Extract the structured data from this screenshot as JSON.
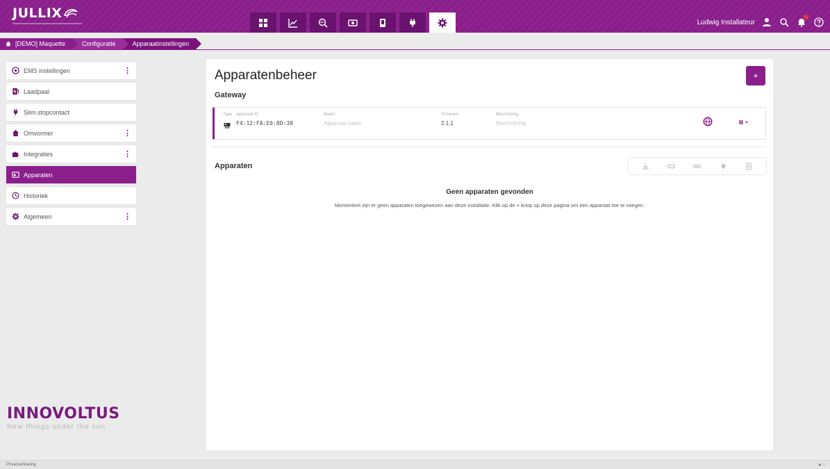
{
  "app": {
    "logo": "JULLIX"
  },
  "colors": {
    "brand": "#8a1f8c",
    "brand_dark": "#6a1270",
    "panel": "#ffffff",
    "background": "#ebebeb",
    "notification": "#e53935"
  },
  "header": {
    "nav_tabs": [
      {
        "icon": "dashboard-icon",
        "active": false
      },
      {
        "icon": "chart-icon",
        "active": false
      },
      {
        "icon": "analytics-icon",
        "active": false
      },
      {
        "icon": "money-icon",
        "active": false
      },
      {
        "icon": "phone-icon",
        "active": false
      },
      {
        "icon": "plug-icon",
        "active": false
      },
      {
        "icon": "gear-icon",
        "active": true
      }
    ],
    "user_name": "Ludwig Installateur"
  },
  "breadcrumb": {
    "home": "[DEMO] Maquette",
    "level2": "Configuratie",
    "level3": "Apparaatinstellingen"
  },
  "sidebar": {
    "items": [
      {
        "label": "EMS instellingen",
        "icon": "ems-icon",
        "has_menu": true
      },
      {
        "label": "Laadpaal",
        "icon": "charger-icon",
        "has_menu": false
      },
      {
        "label": "Slim stopcontact",
        "icon": "plug-icon",
        "has_menu": false
      },
      {
        "label": "Omvormer",
        "icon": "home-icon",
        "has_menu": true
      },
      {
        "label": "Integraties",
        "icon": "puzzle-icon",
        "has_menu": true
      },
      {
        "label": "Apparaten",
        "icon": "device-icon",
        "has_menu": false,
        "active": true
      },
      {
        "label": "Historiek",
        "icon": "history-icon",
        "has_menu": false
      },
      {
        "label": "Algemeen",
        "icon": "gear-icon",
        "has_menu": true
      }
    ],
    "brand": {
      "name": "INNOVOLTUS",
      "tagline": "New things under the sun"
    }
  },
  "main": {
    "title": "Apparatenbeheer",
    "add_label": "+",
    "gateway": {
      "title": "Gateway",
      "type_label": "Type",
      "device_id_label": "Apparaat ID",
      "device_id": "F4:12:FA:E0:8D:38",
      "name_label": "Naam",
      "name_placeholder": "Apparaat naam",
      "firmware_label": "Firmware",
      "firmware": "2.1.1",
      "description_label": "Beschrijving",
      "description_placeholder": "Beschrijving"
    },
    "devices": {
      "title": "Apparaten",
      "empty_title": "Geen apparaten gevonden",
      "empty_text": "Momenteel zijn er geen apparaten toegewezen aan deze installatie. Klik op de + knop op deze pagina om een apparaat toe te voegen."
    }
  },
  "footer": {
    "text": "Privacverklaring"
  }
}
